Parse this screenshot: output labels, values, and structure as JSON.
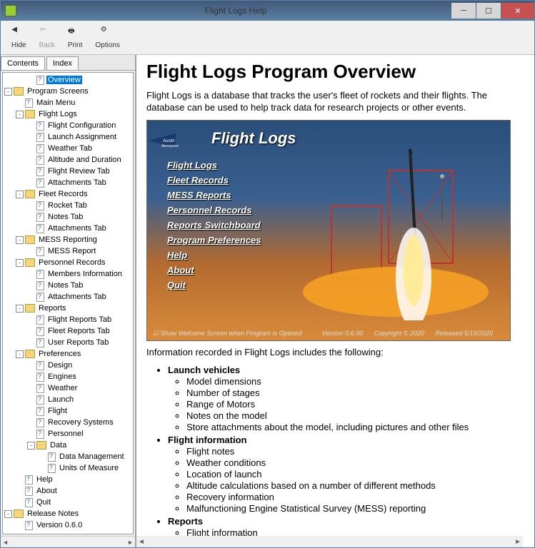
{
  "window": {
    "title": "Flight Logs Help"
  },
  "toolbar": [
    {
      "id": "hide",
      "label": "Hide",
      "disabled": false
    },
    {
      "id": "back",
      "label": "Back",
      "disabled": true
    },
    {
      "id": "print",
      "label": "Print",
      "disabled": false
    },
    {
      "id": "options",
      "label": "Options",
      "disabled": false
    }
  ],
  "navtabs": {
    "contents": "Contents",
    "index": "Index"
  },
  "tree": [
    {
      "depth": 2,
      "toggle": "",
      "icon": "page",
      "label": "Overview",
      "selected": true
    },
    {
      "depth": 0,
      "toggle": "-",
      "icon": "folder",
      "label": "Program Screens"
    },
    {
      "depth": 1,
      "toggle": "",
      "icon": "page",
      "label": "Main Menu"
    },
    {
      "depth": 1,
      "toggle": "-",
      "icon": "folder",
      "label": "Flight Logs"
    },
    {
      "depth": 2,
      "toggle": "",
      "icon": "page",
      "label": "Flight Configuration"
    },
    {
      "depth": 2,
      "toggle": "",
      "icon": "page",
      "label": "Launch Assignment"
    },
    {
      "depth": 2,
      "toggle": "",
      "icon": "page",
      "label": "Weather Tab"
    },
    {
      "depth": 2,
      "toggle": "",
      "icon": "page",
      "label": "Altitude and Duration"
    },
    {
      "depth": 2,
      "toggle": "",
      "icon": "page",
      "label": "Flight Review Tab"
    },
    {
      "depth": 2,
      "toggle": "",
      "icon": "page",
      "label": "Attachments Tab"
    },
    {
      "depth": 1,
      "toggle": "-",
      "icon": "folder",
      "label": "Fleet Records"
    },
    {
      "depth": 2,
      "toggle": "",
      "icon": "page",
      "label": "Rocket Tab"
    },
    {
      "depth": 2,
      "toggle": "",
      "icon": "page",
      "label": "Notes Tab"
    },
    {
      "depth": 2,
      "toggle": "",
      "icon": "page",
      "label": "Attachments Tab"
    },
    {
      "depth": 1,
      "toggle": "-",
      "icon": "folder",
      "label": "MESS Reporting"
    },
    {
      "depth": 2,
      "toggle": "",
      "icon": "page",
      "label": "MESS Report"
    },
    {
      "depth": 1,
      "toggle": "-",
      "icon": "folder",
      "label": "Personnel Records"
    },
    {
      "depth": 2,
      "toggle": "",
      "icon": "page",
      "label": "Members Information"
    },
    {
      "depth": 2,
      "toggle": "",
      "icon": "page",
      "label": "Notes Tab"
    },
    {
      "depth": 2,
      "toggle": "",
      "icon": "page",
      "label": "Attachments Tab"
    },
    {
      "depth": 1,
      "toggle": "-",
      "icon": "folder",
      "label": "Reports"
    },
    {
      "depth": 2,
      "toggle": "",
      "icon": "page",
      "label": "Flight Reports Tab"
    },
    {
      "depth": 2,
      "toggle": "",
      "icon": "page",
      "label": "Fleet Reports Tab"
    },
    {
      "depth": 2,
      "toggle": "",
      "icon": "page",
      "label": "User Reports Tab"
    },
    {
      "depth": 1,
      "toggle": "-",
      "icon": "folder",
      "label": "Preferences"
    },
    {
      "depth": 2,
      "toggle": "",
      "icon": "page",
      "label": "Design"
    },
    {
      "depth": 2,
      "toggle": "",
      "icon": "page",
      "label": "Engines"
    },
    {
      "depth": 2,
      "toggle": "",
      "icon": "page",
      "label": "Weather"
    },
    {
      "depth": 2,
      "toggle": "",
      "icon": "page",
      "label": "Launch"
    },
    {
      "depth": 2,
      "toggle": "",
      "icon": "page",
      "label": "Flight"
    },
    {
      "depth": 2,
      "toggle": "",
      "icon": "page",
      "label": "Recovery Systems"
    },
    {
      "depth": 2,
      "toggle": "",
      "icon": "page",
      "label": "Personnel"
    },
    {
      "depth": 2,
      "toggle": "-",
      "icon": "folder",
      "label": "Data"
    },
    {
      "depth": 3,
      "toggle": "",
      "icon": "page",
      "label": "Data Management"
    },
    {
      "depth": 3,
      "toggle": "",
      "icon": "page",
      "label": "Units of Measure"
    },
    {
      "depth": 1,
      "toggle": "",
      "icon": "page",
      "label": "Help"
    },
    {
      "depth": 1,
      "toggle": "",
      "icon": "page",
      "label": "About"
    },
    {
      "depth": 1,
      "toggle": "",
      "icon": "page",
      "label": "Quit"
    },
    {
      "depth": 0,
      "toggle": "-",
      "icon": "folder",
      "label": "Release Notes"
    },
    {
      "depth": 1,
      "toggle": "",
      "icon": "page",
      "label": "Version 0.6.0"
    }
  ],
  "content": {
    "title": "Flight Logs Program Overview",
    "intro": "Flight Logs is a database that tracks the user's fleet of rockets and their flights. The database can be used to help track data for research projects or other events.",
    "screenshot": {
      "logo_text": "Austin Aerospace",
      "program_title": "Flight Logs",
      "menu": [
        "Flight Logs",
        "Fleet Records",
        "MESS Reports",
        "Personnel Records",
        "Reports Switchboard",
        "Program Preferences",
        "Help",
        "About",
        "Quit"
      ],
      "footer_left": "Show Welcome Screen when Program is Opened",
      "footer_version": "Version  0.6.00",
      "footer_copyright": "Copyright © 2020",
      "footer_released": "Released   5/15/2020"
    },
    "section_lead": "Information recorded in Flight Logs includes the following:",
    "bullets": [
      {
        "title": "Launch vehicles",
        "items": [
          "Model dimensions",
          "Number of stages",
          "Range of Motors",
          "Notes on the model",
          "Store attachments about the model, including pictures and other files"
        ]
      },
      {
        "title": "Flight information",
        "items": [
          "Flight notes",
          "Weather conditions",
          "Location of launch",
          "Altitude calculations based on a number of different methods",
          "Recovery information",
          "Malfunctioning Engine Statistical Survey (MESS) reporting"
        ]
      },
      {
        "title": "Reports",
        "items": [
          "Flight information"
        ]
      }
    ]
  }
}
